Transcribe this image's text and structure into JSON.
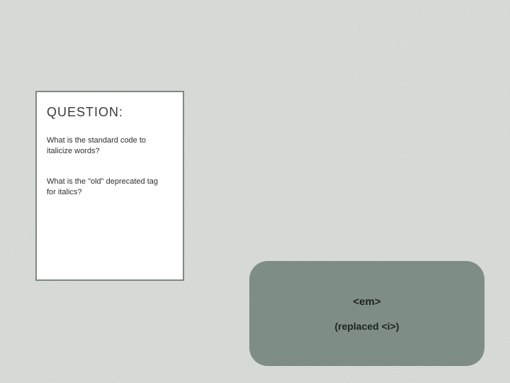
{
  "question_box": {
    "heading": "QUESTION:",
    "q1": "What is the standard code to italicize words?",
    "q2": "What is the \"old\" deprecated tag for italics?"
  },
  "answer_box": {
    "line1": "<em>",
    "line2": "(replaced <i>)"
  }
}
